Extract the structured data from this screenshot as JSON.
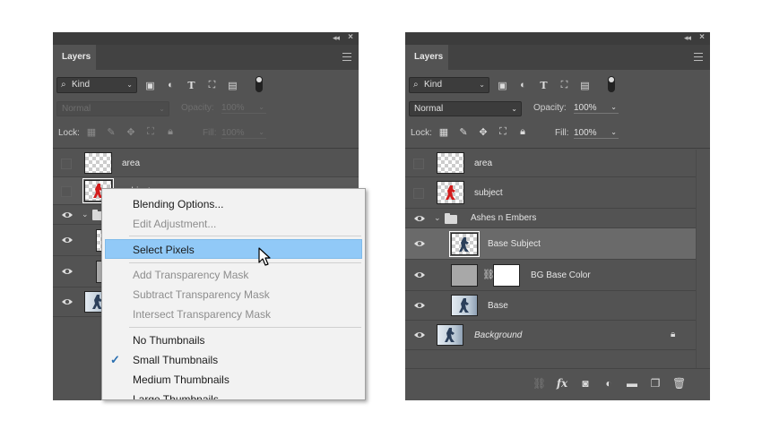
{
  "left_panel": {
    "tab": "Layers",
    "kind_filter": "Kind",
    "blend_mode": "Normal",
    "opacity_label": "Opacity:",
    "opacity_value": "100%",
    "lock_label": "Lock:",
    "fill_label": "Fill:",
    "fill_value": "100%",
    "layers": [
      {
        "name": "area",
        "visible": false
      },
      {
        "name": "subject",
        "visible": false
      },
      {
        "name": "",
        "visible": true
      },
      {
        "name": "",
        "visible": true
      },
      {
        "name": "",
        "visible": true
      },
      {
        "name": "",
        "visible": true
      }
    ]
  },
  "context_menu": {
    "items": [
      {
        "label": "Blending Options...",
        "enabled": true
      },
      {
        "label": "Edit Adjustment...",
        "enabled": false
      },
      {
        "label": "Select Pixels",
        "enabled": true,
        "highlighted": true
      },
      {
        "label": "Add Transparency Mask",
        "enabled": false
      },
      {
        "label": "Subtract Transparency Mask",
        "enabled": false
      },
      {
        "label": "Intersect Transparency Mask",
        "enabled": false
      },
      {
        "label": "No Thumbnails",
        "enabled": true
      },
      {
        "label": "Small Thumbnails",
        "enabled": true,
        "checked": true
      },
      {
        "label": "Medium Thumbnails",
        "enabled": true
      },
      {
        "label": "Large Thumbnails",
        "enabled": true
      }
    ]
  },
  "right_panel": {
    "tab": "Layers",
    "kind_filter": "Kind",
    "blend_mode": "Normal",
    "opacity_label": "Opacity:",
    "opacity_value": "100%",
    "lock_label": "Lock:",
    "fill_label": "Fill:",
    "fill_value": "100%",
    "layers": [
      {
        "name": "area",
        "visible": false
      },
      {
        "name": "subject",
        "visible": false
      },
      {
        "name": "Ashes n Embers",
        "visible": true,
        "type": "group"
      },
      {
        "name": "Base Subject",
        "visible": true,
        "selected": true
      },
      {
        "name": "BG Base Color",
        "visible": true
      },
      {
        "name": "Base",
        "visible": true
      },
      {
        "name": "Background",
        "visible": true,
        "locked": true
      }
    ]
  },
  "icons": {
    "eye": "eye-icon",
    "lock": "lock-icon",
    "folder": "folder-icon",
    "fx": "fx"
  },
  "colors": {
    "panel_bg": "#535353",
    "menu_highlight": "#91c9f7",
    "check": "#2a6fb0"
  }
}
